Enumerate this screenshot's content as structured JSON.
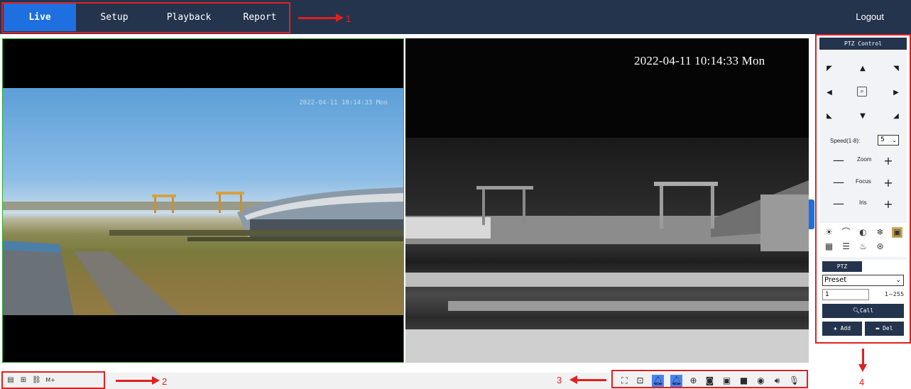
{
  "nav": {
    "tabs": [
      {
        "label": "Live",
        "active": true
      },
      {
        "label": "Setup",
        "active": false
      },
      {
        "label": "Playback",
        "active": false
      },
      {
        "label": "Report",
        "active": false
      }
    ],
    "logout": "Logout"
  },
  "annotations": {
    "n1": "1",
    "n2": "2",
    "n3": "3",
    "n4": "4"
  },
  "video": {
    "left_osd": "2022-04-11 10:14:33 Mon",
    "right_osd": "2022-04-11 10:14:33 Mon"
  },
  "ptz": {
    "title": "PTZ Control",
    "speed_label": "Speed(1-8):",
    "speed_value": "5",
    "zoom": "Zoom",
    "focus": "Focus",
    "iris": "Iris",
    "minus": "—",
    "plus": "+",
    "sub_tab": "PTZ",
    "preset_option": "Preset",
    "preset_value": "1",
    "preset_range": "1~255",
    "call": "Call",
    "add": "Add",
    "del": "Del"
  },
  "colors": {
    "nav_bg": "#25344d",
    "active_tab": "#1e6fe0",
    "annotation": "#e02020",
    "video_border": "#2bb02b",
    "toggle_on": "#4a82f0"
  },
  "icons": {
    "bottom_left": [
      "stream-switch-icon",
      "bitrate-icon",
      "link-icon",
      "mplus-icon"
    ],
    "bottom_right": [
      "fit-screen-icon",
      "full-screen-icon",
      "alarm-in-icon",
      "alarm-out-icon",
      "zoom-in-icon",
      "snapshot-icon",
      "three-d-position-icon",
      "record-icon",
      "ptz-position-icon",
      "audio-icon",
      "talk-icon"
    ],
    "ptz_tools": [
      "light-icon",
      "wiper-icon",
      "auto-scan-icon",
      "snow-icon",
      "image-icon",
      "defog-icon",
      "menu-icon",
      "heater-icon",
      "focus-assist-icon"
    ]
  },
  "bottom_left_text": "M+"
}
